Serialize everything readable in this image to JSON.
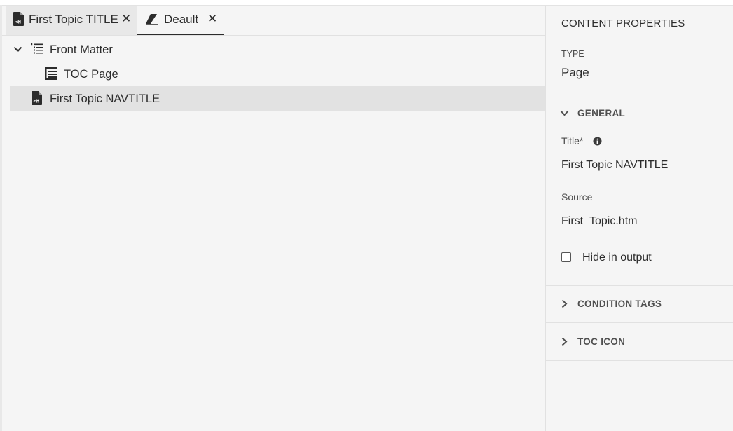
{
  "tabs": [
    {
      "label": "First Topic TITLE",
      "icon": "topic-file-icon",
      "close": "✕"
    },
    {
      "label": "Deault",
      "icon": "eraser-icon",
      "close": "✕"
    }
  ],
  "tree": [
    {
      "label": "Front Matter",
      "icon": "list-indent-icon",
      "expanded": true
    },
    {
      "label": "TOC Page",
      "icon": "toc-icon"
    },
    {
      "label": "First Topic NAVTITLE",
      "icon": "topic-file-icon",
      "selected": true
    }
  ],
  "properties": {
    "heading": "CONTENT PROPERTIES",
    "type_label": "TYPE",
    "type_value": "Page",
    "general_label": "GENERAL",
    "title_label": "Title",
    "required_mark": "*",
    "title_value": "First Topic NAVTITLE",
    "source_label": "Source",
    "source_value": "First_Topic.htm",
    "hide_label": "Hide in output",
    "condition_label": "CONDITION TAGS",
    "tocicon_label": "TOC ICON"
  },
  "colors": {
    "selected_row": "#e2e2e2",
    "active_tab": "#e8e8e8",
    "text": "#2c2c2c"
  }
}
